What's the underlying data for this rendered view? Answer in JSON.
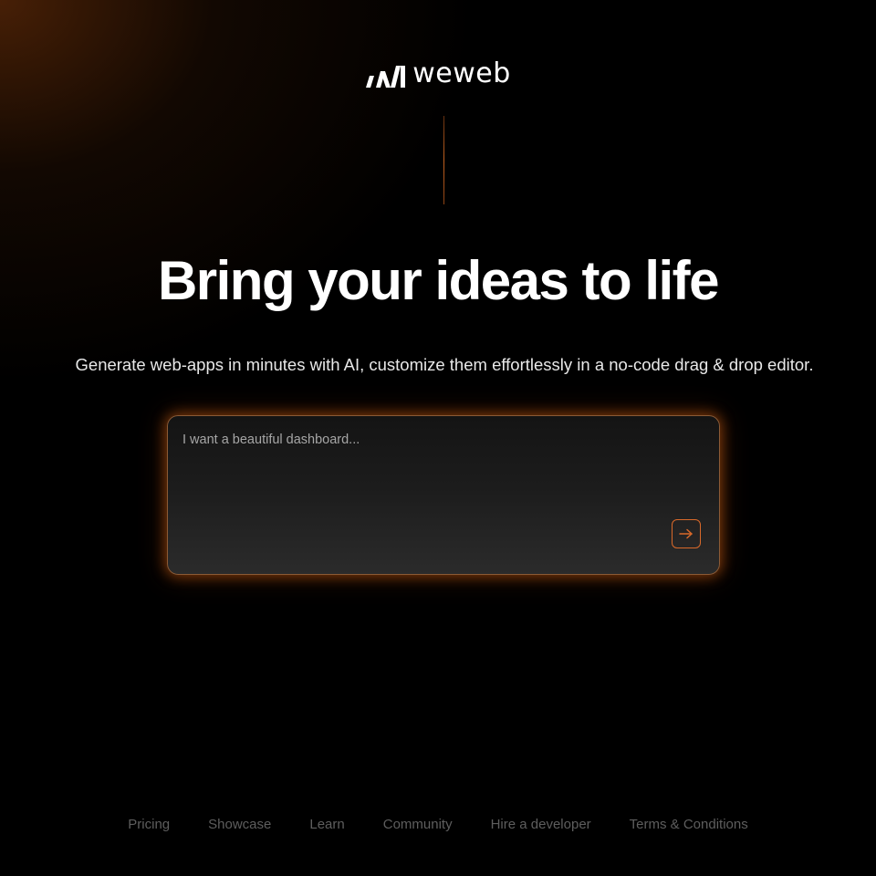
{
  "brand": {
    "name": "weweb",
    "logo_icon": "weweb-logo-icon",
    "accent_color": "#d9692a"
  },
  "hero": {
    "headline": "Bring your ideas to life",
    "subheadline": "Generate web-apps in minutes with AI, customize them effortlessly in a no-code drag & drop editor."
  },
  "prompt": {
    "placeholder": "I want a beautiful dashboard...",
    "value": "",
    "submit_icon": "arrow-right-icon"
  },
  "footer": {
    "links": [
      {
        "label": "Pricing"
      },
      {
        "label": "Showcase"
      },
      {
        "label": "Learn"
      },
      {
        "label": "Community"
      },
      {
        "label": "Hire a developer"
      },
      {
        "label": "Terms & Conditions"
      }
    ]
  }
}
